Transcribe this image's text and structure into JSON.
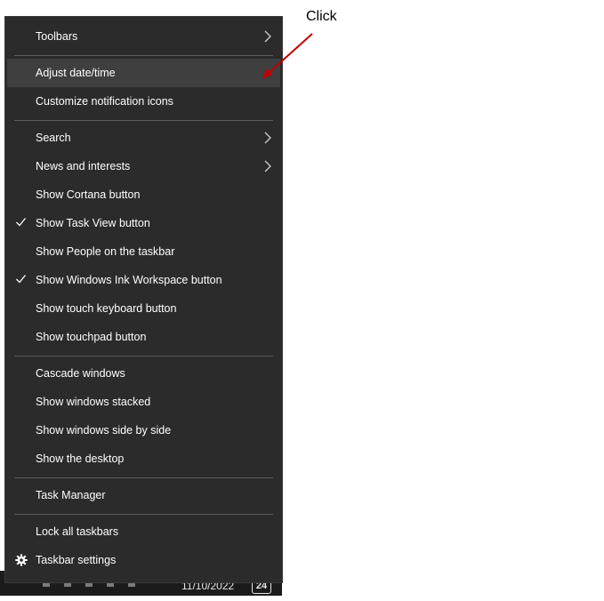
{
  "menu": {
    "items": [
      {
        "label": "Toolbars"
      },
      {
        "label": "Adjust date/time"
      },
      {
        "label": "Customize notification icons"
      },
      {
        "label": "Search"
      },
      {
        "label": "News and interests"
      },
      {
        "label": "Show Cortana button"
      },
      {
        "label": "Show Task View button"
      },
      {
        "label": "Show People on the taskbar"
      },
      {
        "label": "Show Windows Ink Workspace button"
      },
      {
        "label": "Show touch keyboard button"
      },
      {
        "label": "Show touchpad button"
      },
      {
        "label": "Cascade windows"
      },
      {
        "label": "Show windows stacked"
      },
      {
        "label": "Show windows side by side"
      },
      {
        "label": "Show the desktop"
      },
      {
        "label": "Task Manager"
      },
      {
        "label": "Lock all taskbars"
      },
      {
        "label": "Taskbar settings"
      }
    ],
    "checked_items": [
      "Show Task View button",
      "Show Windows Ink Workspace button"
    ],
    "submenu_items": [
      "Toolbars",
      "Search",
      "News and interests"
    ],
    "highlighted_item": "Adjust date/time"
  },
  "annotation": {
    "text": "Click",
    "arrow_color": "#c00000"
  },
  "taskbar": {
    "clock": "11/10/2022",
    "notification_count": "24"
  },
  "icons": {
    "check": "check-icon",
    "submenu": "chevron-right-icon",
    "settings": "gear-icon"
  },
  "colors": {
    "menu_background": "#2b2b2b",
    "hover_background": "#3f3f3f",
    "separator": "#5a5a5a",
    "text": "#ffffff"
  }
}
